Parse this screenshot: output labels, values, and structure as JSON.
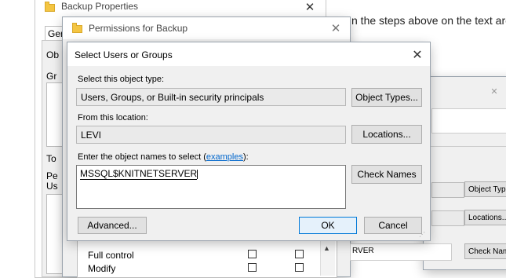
{
  "backdrop": {
    "text_line": "n the steps above on the text are"
  },
  "backup_properties": {
    "title": "Backup Properties",
    "tab_partial": "Gen",
    "obj_partial": "Ob",
    "group_partial": "Gr",
    "to_partial": "To",
    "pe_partial": "Pe",
    "us_partial": "Us"
  },
  "permissions_window": {
    "title": "Permissions for Backup",
    "permissions": [
      {
        "name": "Full control"
      },
      {
        "name": "Modify"
      }
    ]
  },
  "right_dialog": {
    "object_types_label": "Object Type",
    "locations_label": "Locations...",
    "names_value": "RVER",
    "check_names_label": "Check Nam"
  },
  "select_dialog": {
    "title": "Select Users or Groups",
    "object_type_label": "Select this object type:",
    "object_type_value": "Users, Groups, or Built-in security principals",
    "object_types_button": "Object Types...",
    "location_label": "From this location:",
    "location_value": "LEVI",
    "locations_button": "Locations...",
    "names_label_prefix": "Enter the object names to select (",
    "names_label_link": "examples",
    "names_label_suffix": "):",
    "names_value": "MSSQL$KNITNETSERVER",
    "check_names_button": "Check Names",
    "advanced_button": "Advanced...",
    "ok_button": "OK",
    "cancel_button": "Cancel"
  }
}
